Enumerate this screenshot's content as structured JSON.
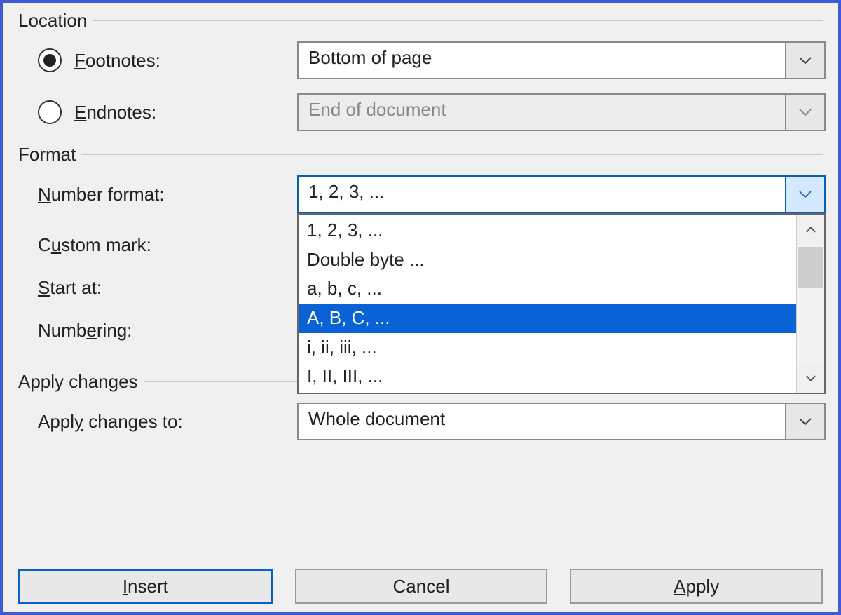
{
  "sections": {
    "location": "Location",
    "format": "Format",
    "apply": "Apply changes"
  },
  "location": {
    "footnotes_label_pre": "",
    "footnotes_letter": "F",
    "footnotes_label_post": "ootnotes:",
    "endnotes_letter": "E",
    "endnotes_label_post": "ndnotes:",
    "footnotes_value": "Bottom of page",
    "endnotes_value": "End of document",
    "footnotes_checked": true,
    "endnotes_checked": false
  },
  "format": {
    "number_format_letter": "N",
    "number_format_post": "umber format:",
    "number_format_value": "1, 2, 3, ...",
    "custom_mark_pre": "C",
    "custom_mark_letter": "u",
    "custom_mark_post": "stom mark:",
    "start_at_letter": "S",
    "start_at_post": "tart at:",
    "numbering_pre": "Numb",
    "numbering_letter": "e",
    "numbering_post": "ring:",
    "dropdown_items": [
      "1, 2, 3, ...",
      "Double byte ...",
      "a, b, c, ...",
      "A, B, C, ...",
      "i, ii, iii, ...",
      "I, II, III, ..."
    ],
    "dropdown_selected_index": 3
  },
  "apply": {
    "label_pre": "Appl",
    "label_letter": "y",
    "label_post": " changes to:",
    "value": "Whole document"
  },
  "buttons": {
    "insert_letter": "I",
    "insert_post": "nsert",
    "cancel": "Cancel",
    "apply_letter": "A",
    "apply_post": "pply"
  }
}
